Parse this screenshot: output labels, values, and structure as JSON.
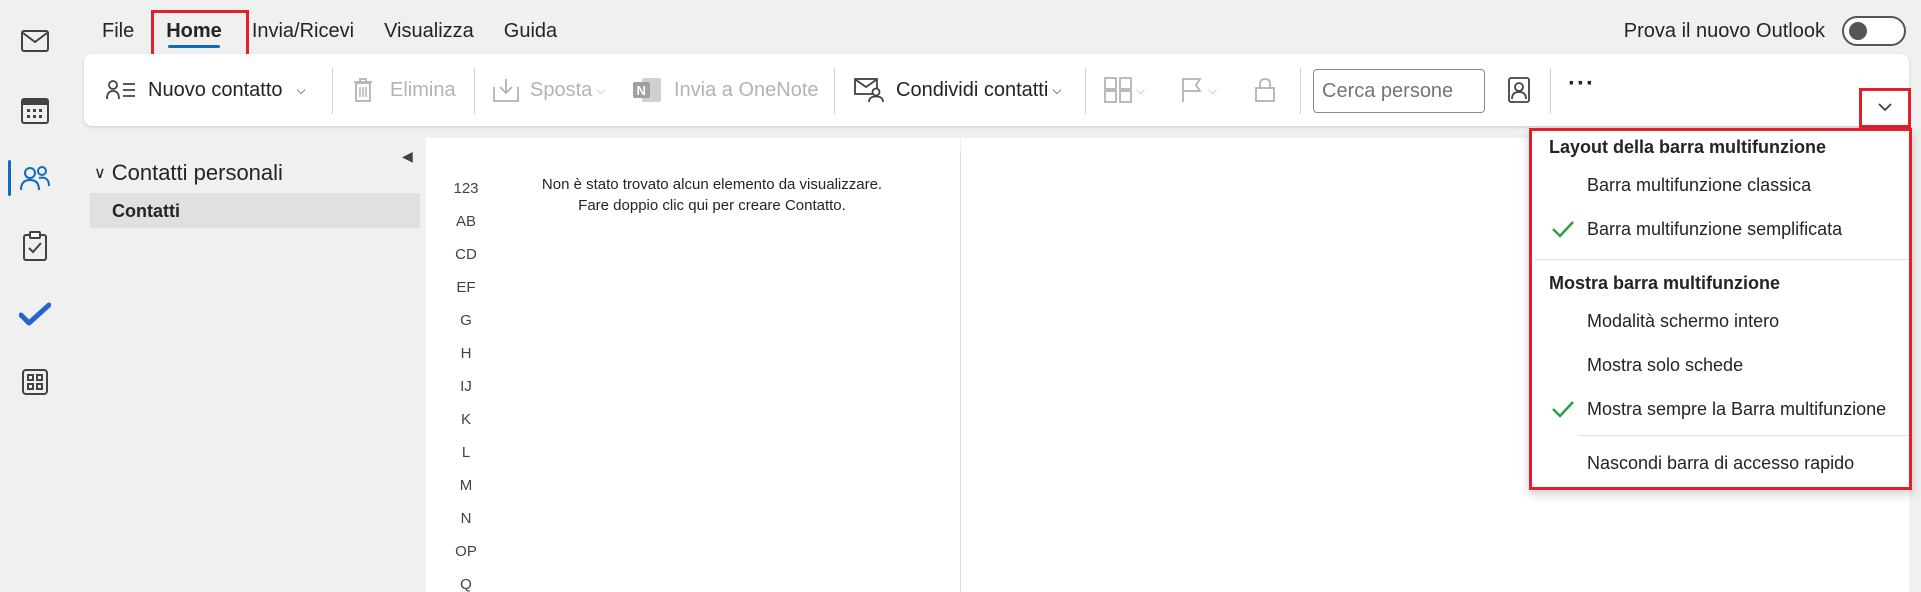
{
  "menu": {
    "tabs": [
      {
        "label": "File"
      },
      {
        "label": "Home"
      },
      {
        "label": "Invia/Ricevi"
      },
      {
        "label": "Visualizza"
      },
      {
        "label": "Guida"
      }
    ],
    "new_outlook_label": "Prova il nuovo Outlook"
  },
  "ribbon": {
    "new_contact": "Nuovo contatto",
    "delete": "Elimina",
    "move": "Sposta",
    "onenote": "Invia a OneNote",
    "share_contacts": "Condividi contatti",
    "search_placeholder": "Cerca persone",
    "more": "···"
  },
  "folders": {
    "group_label": "Contatti personali",
    "items": [
      {
        "label": "Contatti"
      }
    ]
  },
  "list": {
    "index_letters": [
      "123",
      "AB",
      "CD",
      "EF",
      "G",
      "H",
      "IJ",
      "K",
      "L",
      "M",
      "N",
      "OP",
      "Q"
    ],
    "empty_line1": "Non è stato trovato alcun elemento da visualizzare.",
    "empty_line2": "Fare doppio clic qui per creare Contatto."
  },
  "ribbon_menu": {
    "layout_header": "Layout della barra multifunzione",
    "layout_items": [
      {
        "label": "Barra multifunzione classica",
        "checked": false
      },
      {
        "label": "Barra multifunzione semplificata",
        "checked": true
      }
    ],
    "show_header": "Mostra barra multifunzione",
    "show_items": [
      {
        "label": "Modalità schermo intero",
        "checked": false
      },
      {
        "label": "Mostra solo schede",
        "checked": false
      },
      {
        "label": "Mostra sempre la Barra multifunzione",
        "checked": true
      }
    ],
    "hide_quick_access": "Nascondi barra di accesso rapido"
  },
  "colors": {
    "accent": "#0f6cbd",
    "highlight": "#e0202b",
    "check": "#2e9e44"
  }
}
